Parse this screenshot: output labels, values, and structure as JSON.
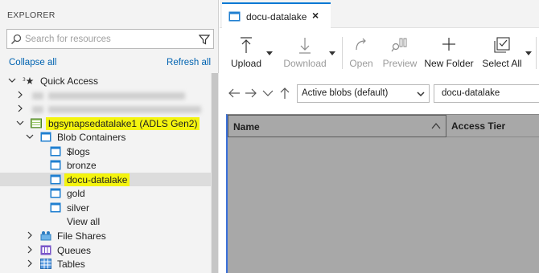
{
  "explorer": {
    "title": "EXPLORER",
    "search_placeholder": "Search for resources",
    "collapse_all": "Collapse all",
    "refresh_all": "Refresh all"
  },
  "tree": {
    "quick_access": "Quick Access",
    "storage_account": "bgsynapsedatalake1 (ADLS Gen2)",
    "blob_containers": "Blob Containers",
    "containers": [
      "$logs",
      "bronze",
      "docu-datalake",
      "gold",
      "silver"
    ],
    "view_all": "View all",
    "file_shares": "File Shares",
    "queues": "Queues",
    "tables": "Tables"
  },
  "tab": {
    "label": "docu-datalake",
    "close": "×"
  },
  "toolbar": {
    "upload": "Upload",
    "download": "Download",
    "open": "Open",
    "preview": "Preview",
    "new_folder": "New Folder",
    "select_all": "Select All"
  },
  "nav": {
    "view_option": "Active blobs (default)",
    "path": "docu-datalake"
  },
  "grid": {
    "columns": [
      "Name",
      "Access Tier"
    ]
  },
  "colors": {
    "accent": "#0078d4",
    "link": "#0063b1",
    "highlight": "#f4f40f",
    "container_icon": "#1f7fd0"
  }
}
